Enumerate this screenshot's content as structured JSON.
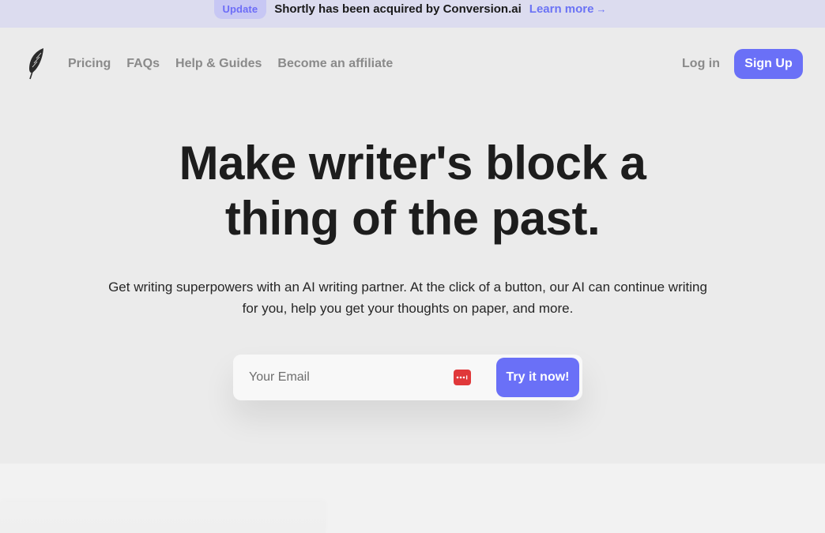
{
  "announcement": {
    "badge": "Update",
    "text": "Shortly has been acquired by Conversion.ai",
    "link_label": "Learn more",
    "link_arrow": "→"
  },
  "nav": {
    "logo_icon": "feather-icon",
    "links": [
      "Pricing",
      "FAQs",
      "Help & Guides",
      "Become an affiliate"
    ],
    "login_label": "Log in",
    "signup_label": "Sign Up"
  },
  "hero": {
    "title_line1": "Make writer's block a",
    "title_line2": "thing of the past.",
    "subtitle": "Get writing superpowers with an AI writing partner. At the click of a button, our AI can continue writing for you, help you get your thoughts on paper, and more."
  },
  "form": {
    "email_placeholder": "Your Email",
    "password_manager_icon": "password-manager-icon",
    "submit_label": "Try it now!"
  },
  "colors": {
    "accent": "#6a70f7",
    "banner_bg": "#dcdcef",
    "page_bg": "#ebebeb",
    "password_icon": "#e0383a"
  }
}
